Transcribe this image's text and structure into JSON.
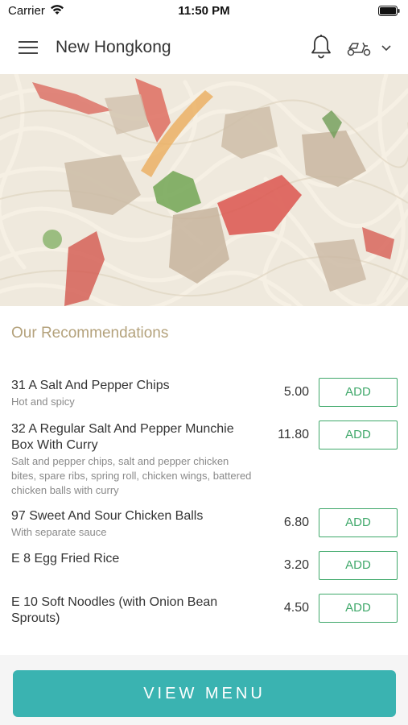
{
  "status_bar": {
    "carrier": "Carrier",
    "time": "11:50 PM"
  },
  "header": {
    "title": "New Hongkong"
  },
  "recommendations": {
    "title": "Our Recommendations",
    "items": [
      {
        "name": "31 A Salt And Pepper Chips",
        "description": "Hot and spicy",
        "price": "5.00",
        "add_label": "ADD"
      },
      {
        "name": "32 A Regular Salt And Pepper Munchie Box With Curry",
        "description": "Salt and pepper chips, salt and pepper chicken bites, spare ribs, spring roll, chicken wings, battered chicken balls with curry",
        "price": "11.80",
        "add_label": "ADD"
      },
      {
        "name": "97 Sweet And Sour Chicken Balls",
        "description": "With separate sauce",
        "price": "6.80",
        "add_label": "ADD"
      },
      {
        "name": "E 8 Egg Fried Rice",
        "description": "",
        "price": "3.20",
        "add_label": "ADD"
      },
      {
        "name": "E 10 Soft Noodles (with Onion Bean Sprouts)",
        "description": "",
        "price": "4.50",
        "add_label": "ADD"
      }
    ]
  },
  "footer": {
    "view_menu_label": "VIEW MENU"
  },
  "colors": {
    "accent_teal": "#3ab3b1",
    "add_green": "#3fa86a",
    "section_gold": "#b4a27c"
  },
  "icons": [
    "wifi-icon",
    "battery-icon",
    "menu-icon",
    "bell-icon",
    "scooter-icon",
    "chevron-down-icon"
  ]
}
